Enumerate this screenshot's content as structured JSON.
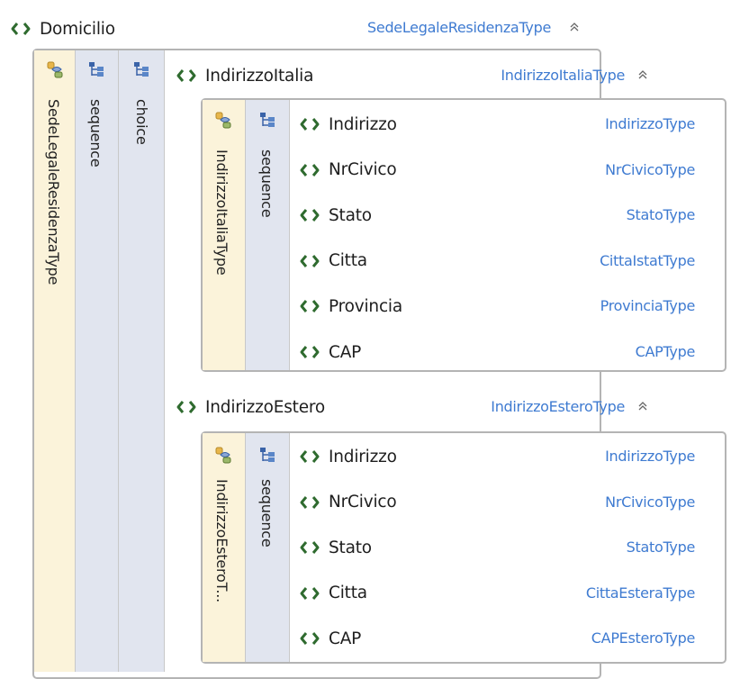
{
  "colors": {
    "type_link": "#3f7bd1",
    "type_column_bg": "#fbf3da",
    "compositor_column_bg": "#e1e5ef",
    "border": "#b4b4b4",
    "element_icon": "#2f6b2f"
  },
  "root": {
    "name": "Domicilio",
    "type": "SedeLegaleResidenzaType",
    "collapse_icon": "double-chevron-up",
    "columns": {
      "type_label": "SedeLegaleResidenzaType",
      "sequence_label": "sequence",
      "choice_label": "choice"
    }
  },
  "italia": {
    "name": "IndirizzoItalia",
    "type": "IndirizzoItaliaType",
    "columns": {
      "type_label": "IndirizzoItaliaType",
      "sequence_label": "sequence"
    },
    "children": [
      {
        "name": "Indirizzo",
        "type": "IndirizzoType"
      },
      {
        "name": "NrCivico",
        "type": "NrCivicoType"
      },
      {
        "name": "Stato",
        "type": "StatoType"
      },
      {
        "name": "Citta",
        "type": "CittaIstatType"
      },
      {
        "name": "Provincia",
        "type": "ProvinciaType"
      },
      {
        "name": "CAP",
        "type": "CAPType"
      }
    ]
  },
  "estero": {
    "name": "IndirizzoEstero",
    "type": "IndirizzoEsteroType",
    "columns": {
      "type_label": "IndirizzoEsteroT...",
      "sequence_label": "sequence"
    },
    "children": [
      {
        "name": "Indirizzo",
        "type": "IndirizzoType"
      },
      {
        "name": "NrCivico",
        "type": "NrCivicoType"
      },
      {
        "name": "Stato",
        "type": "StatoType"
      },
      {
        "name": "Citta",
        "type": "CittaEsteraType"
      },
      {
        "name": "CAP",
        "type": "CAPEsteroType"
      }
    ]
  }
}
